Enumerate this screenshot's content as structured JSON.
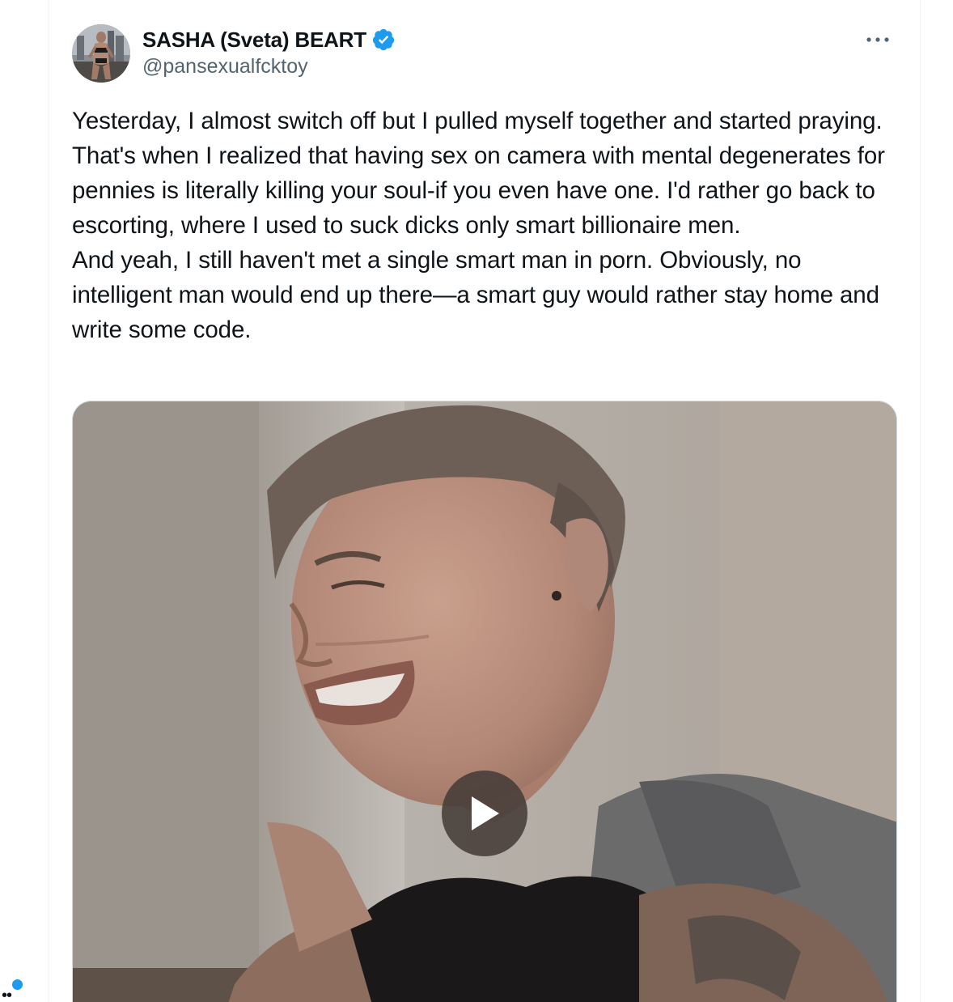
{
  "tweet": {
    "author": {
      "display_name": "SASHA (Sveta) BEART",
      "handle": "@pansexualfcktoy",
      "verified": true,
      "verified_badge_color": "#1d9bf0"
    },
    "more_menu_icon": "more-horizontal-icon",
    "text_paragraphs": [
      "Yesterday, I almost switch off but I pulled myself together and started praying. That's when I realized that having sex on camera with mental degenerates for pennies is literally killing your soul-if you even have one. I'd rather go back to escorting, where I used to suck dicks only smart billionaire men.",
      "And yeah, I still haven't met a single smart man in porn. Obviously, no intelligent man would end up there—a smart guy would rather stay home and write some code."
    ],
    "media": {
      "type": "video",
      "play_icon": "play-icon"
    }
  },
  "left_rail": {
    "notification_dot_color": "#1d9bf0",
    "more_icon": "more-dots-icon"
  },
  "colors": {
    "text_primary": "#0f1419",
    "text_secondary": "#536471",
    "border": "#eff3f4",
    "accent": "#1d9bf0"
  }
}
